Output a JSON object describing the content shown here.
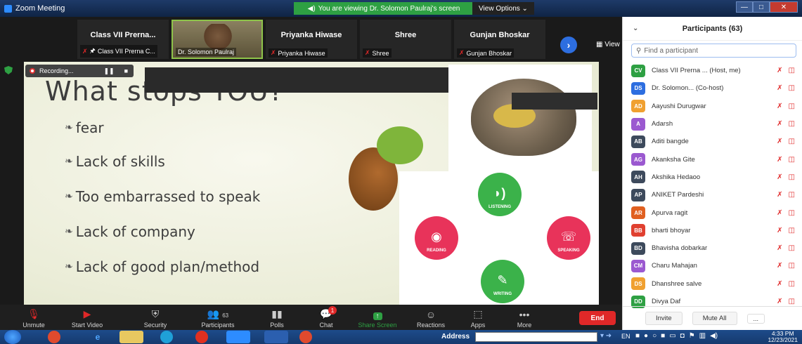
{
  "window": {
    "title": "Zoom Meeting",
    "banner": "You are viewing Dr. Solomon Paulraj's screen",
    "view_options": "View Options ⌄",
    "controls": [
      "—",
      "□",
      "✕"
    ]
  },
  "strip": {
    "tiles": [
      {
        "name": "Class VII Prerna...",
        "label": "Class VII Prerna C..."
      },
      {
        "name": "",
        "label": "Dr. Solomon Paulraj"
      },
      {
        "name": "Priyanka Hiwase",
        "label": "Priyanka Hiwase"
      },
      {
        "name": "Shree",
        "label": "Shree"
      },
      {
        "name": "Gunjan Bhoskar",
        "label": "Gunjan Bhoskar"
      }
    ],
    "next": "›",
    "view": "View"
  },
  "slide": {
    "recording": "Recording...",
    "title": "What stops YOU?",
    "bullets": [
      "fear",
      "Lack of skills",
      "Too embarrassed to speak",
      "Lack of company",
      "Lack of good plan/method"
    ],
    "cycle": [
      "LISTENING",
      "READING",
      "SPEAKING",
      "WRITING"
    ]
  },
  "toolbar": {
    "unmute": "Unmute",
    "start_video": "Start Video",
    "security": "Security",
    "participants": "Participants",
    "participants_count": "63",
    "polls": "Polls",
    "chat": "Chat",
    "chat_badge": "1",
    "share_screen": "Share Screen",
    "reactions": "Reactions",
    "apps": "Apps",
    "more": "More",
    "end": "End"
  },
  "panel": {
    "title": "Participants (63)",
    "search_placeholder": "Find a participant",
    "participants": [
      {
        "initials": "CV",
        "name": "Class VII Prerna ... (Host, me)",
        "color": "#2ea043"
      },
      {
        "initials": "DS",
        "name": "Dr. Solomon... (Co-host)",
        "color": "#2d6ee0"
      },
      {
        "initials": "AD",
        "name": "Aayushi Durugwar",
        "color": "#f0a030"
      },
      {
        "initials": "A",
        "name": "Adarsh",
        "color": "#9b59d0"
      },
      {
        "initials": "AB",
        "name": "Aditi bangde",
        "color": "#3d4a5c"
      },
      {
        "initials": "AG",
        "name": "Akanksha Gite",
        "color": "#9b59d0"
      },
      {
        "initials": "AH",
        "name": "Akshika Hedaoo",
        "color": "#3d4a5c"
      },
      {
        "initials": "AP",
        "name": "ANIKET Pardeshi",
        "color": "#3d4a5c"
      },
      {
        "initials": "AR",
        "name": "Apurva ragit",
        "color": "#e06020"
      },
      {
        "initials": "BB",
        "name": "bharti bhoyar",
        "color": "#e04030"
      },
      {
        "initials": "BD",
        "name": "Bhavisha dobarkar",
        "color": "#3d4a5c"
      },
      {
        "initials": "CM",
        "name": "Charu Mahajan",
        "color": "#9b59d0"
      },
      {
        "initials": "DS",
        "name": "Dhanshree salve",
        "color": "#f0a030"
      },
      {
        "initials": "DD",
        "name": "Divya Daf",
        "color": "#2ea043"
      }
    ],
    "invite": "Invite",
    "mute_all": "Mute All",
    "more": "..."
  },
  "taskbar": {
    "address": "Address",
    "lang": "EN",
    "time": "4:33 PM",
    "date": "12/23/2021"
  }
}
